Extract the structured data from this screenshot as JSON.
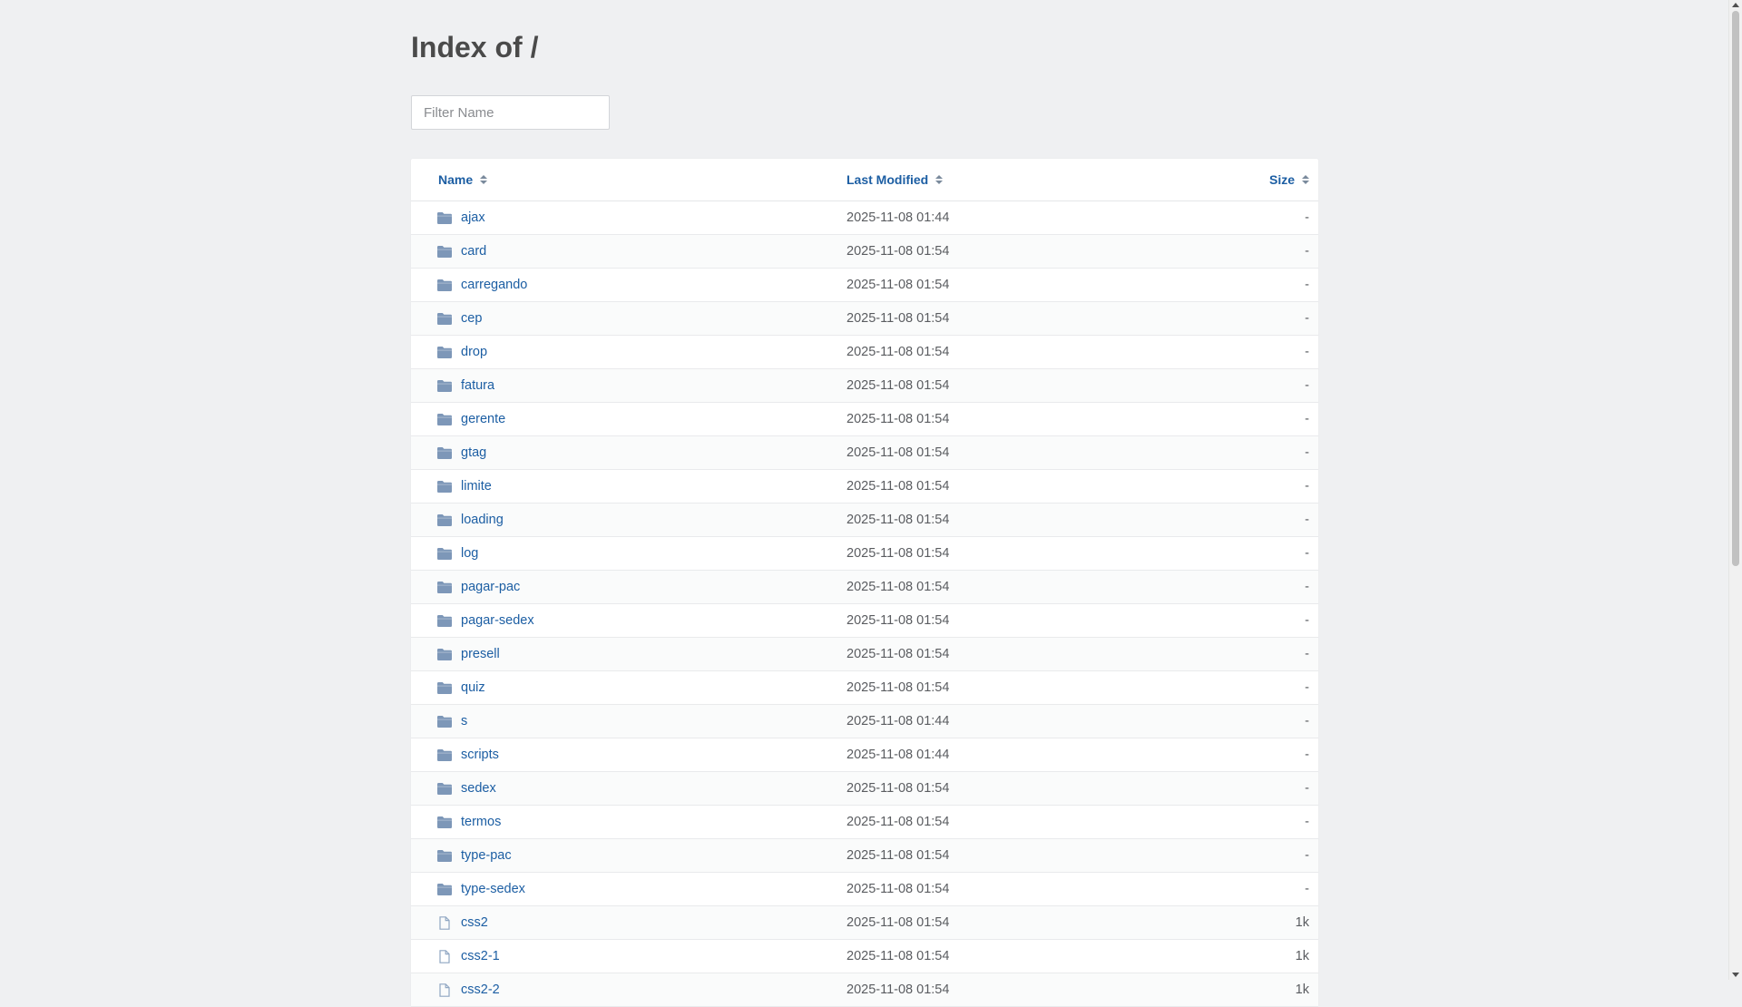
{
  "page": {
    "title": "Index of /",
    "filter_placeholder": "Filter Name"
  },
  "columns": {
    "name": "Name",
    "modified": "Last Modified",
    "size": "Size"
  },
  "colors": {
    "link": "#1c5ea3",
    "folder_icon": "#7d97b8",
    "file_icon": "#8fa6c2"
  },
  "entries": [
    {
      "name": "ajax",
      "modified": "2025-11-08 01:44",
      "size": "-",
      "type": "folder"
    },
    {
      "name": "card",
      "modified": "2025-11-08 01:54",
      "size": "-",
      "type": "folder"
    },
    {
      "name": "carregando",
      "modified": "2025-11-08 01:54",
      "size": "-",
      "type": "folder"
    },
    {
      "name": "cep",
      "modified": "2025-11-08 01:54",
      "size": "-",
      "type": "folder"
    },
    {
      "name": "drop",
      "modified": "2025-11-08 01:54",
      "size": "-",
      "type": "folder"
    },
    {
      "name": "fatura",
      "modified": "2025-11-08 01:54",
      "size": "-",
      "type": "folder"
    },
    {
      "name": "gerente",
      "modified": "2025-11-08 01:54",
      "size": "-",
      "type": "folder"
    },
    {
      "name": "gtag",
      "modified": "2025-11-08 01:54",
      "size": "-",
      "type": "folder"
    },
    {
      "name": "limite",
      "modified": "2025-11-08 01:54",
      "size": "-",
      "type": "folder"
    },
    {
      "name": "loading",
      "modified": "2025-11-08 01:54",
      "size": "-",
      "type": "folder"
    },
    {
      "name": "log",
      "modified": "2025-11-08 01:54",
      "size": "-",
      "type": "folder"
    },
    {
      "name": "pagar-pac",
      "modified": "2025-11-08 01:54",
      "size": "-",
      "type": "folder"
    },
    {
      "name": "pagar-sedex",
      "modified": "2025-11-08 01:54",
      "size": "-",
      "type": "folder"
    },
    {
      "name": "presell",
      "modified": "2025-11-08 01:54",
      "size": "-",
      "type": "folder"
    },
    {
      "name": "quiz",
      "modified": "2025-11-08 01:54",
      "size": "-",
      "type": "folder"
    },
    {
      "name": "s",
      "modified": "2025-11-08 01:44",
      "size": "-",
      "type": "folder"
    },
    {
      "name": "scripts",
      "modified": "2025-11-08 01:44",
      "size": "-",
      "type": "folder"
    },
    {
      "name": "sedex",
      "modified": "2025-11-08 01:54",
      "size": "-",
      "type": "folder"
    },
    {
      "name": "termos",
      "modified": "2025-11-08 01:54",
      "size": "-",
      "type": "folder"
    },
    {
      "name": "type-pac",
      "modified": "2025-11-08 01:54",
      "size": "-",
      "type": "folder"
    },
    {
      "name": "type-sedex",
      "modified": "2025-11-08 01:54",
      "size": "-",
      "type": "folder"
    },
    {
      "name": "css2",
      "modified": "2025-11-08 01:54",
      "size": "1k",
      "type": "file"
    },
    {
      "name": "css2-1",
      "modified": "2025-11-08 01:54",
      "size": "1k",
      "type": "file"
    },
    {
      "name": "css2-2",
      "modified": "2025-11-08 01:54",
      "size": "1k",
      "type": "file"
    }
  ]
}
